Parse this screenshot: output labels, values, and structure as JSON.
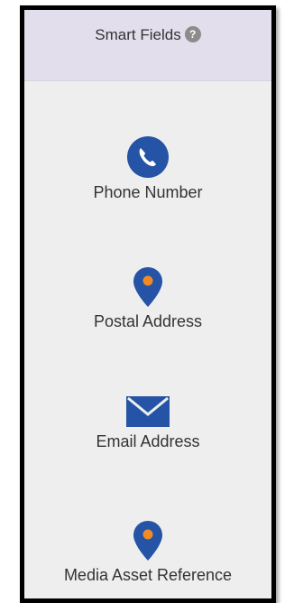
{
  "header": {
    "title": "Smart Fields",
    "help_symbol": "?"
  },
  "fields": [
    {
      "label": "Phone Number",
      "icon": "phone-icon"
    },
    {
      "label": "Postal Address",
      "icon": "map-pin-icon"
    },
    {
      "label": "Email Address",
      "icon": "envelope-icon"
    },
    {
      "label": "Media Asset Reference",
      "icon": "map-pin-icon"
    }
  ],
  "colors": {
    "icon_blue": "#2553a5",
    "pin_dot": "#f08a24",
    "header_bg": "#e2deec",
    "panel_bg": "#efeeef"
  }
}
